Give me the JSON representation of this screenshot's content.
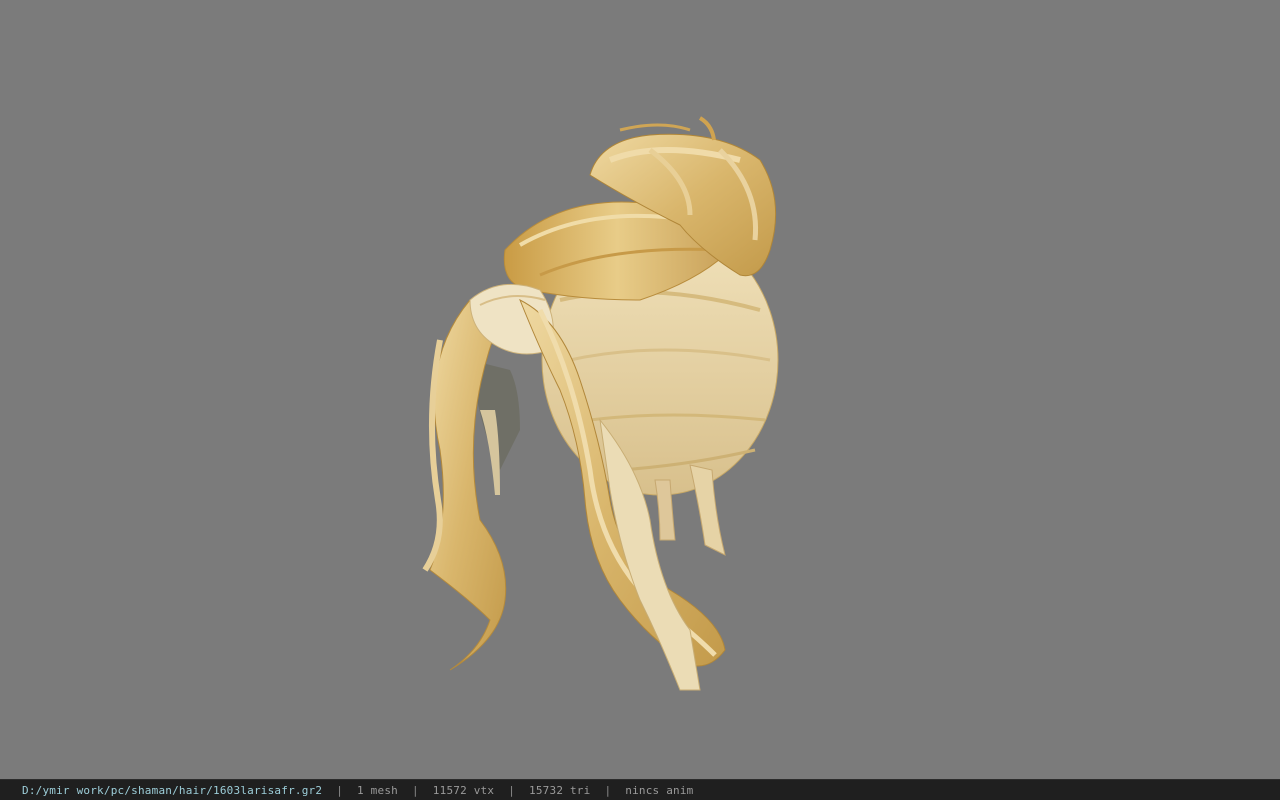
{
  "viewport": {
    "background": "#7b7b7b",
    "model": "hair-model"
  },
  "status_bar": {
    "file_path": "D:/ymir work/pc/shaman/hair/1603larisafr.gr2",
    "separator": "|",
    "mesh": "1 mesh",
    "vertices": "11572 vtx",
    "triangles": "15732 tri",
    "anim": "nincs anim",
    "path_color": "#9ccdd8",
    "text_color": "#9a9a9a"
  }
}
